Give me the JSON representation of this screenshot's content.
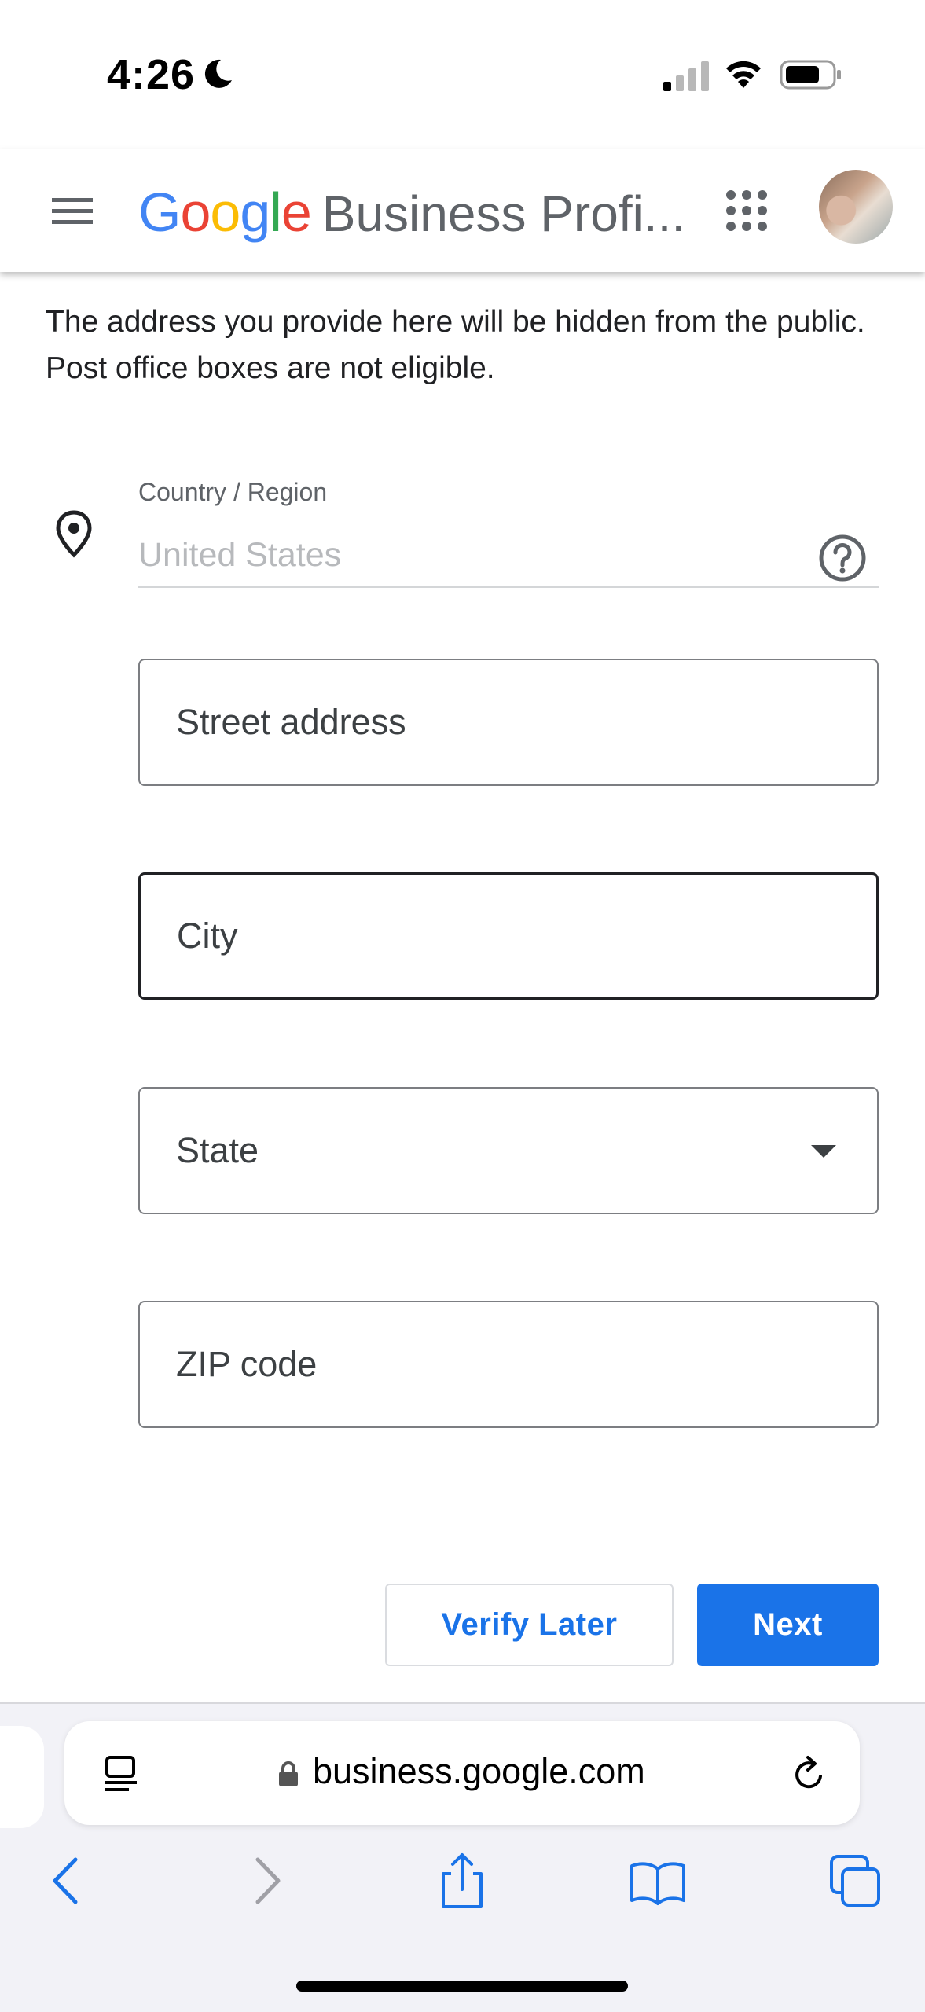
{
  "status_bar": {
    "time": "4:26"
  },
  "header": {
    "logo_text": "Google",
    "product_name": "Business Profi...",
    "logo_colors": [
      "#4285F4",
      "#EA4335",
      "#FBBC05",
      "#4285F4",
      "#34A853",
      "#EA4335"
    ]
  },
  "content": {
    "intro_text": "The address you provide here will be hidden from the public. Post office boxes are not eligible.",
    "country": {
      "label": "Country / Region",
      "value": "United States"
    },
    "fields": {
      "street": {
        "placeholder": "Street address"
      },
      "city": {
        "placeholder": "City"
      },
      "state": {
        "placeholder": "State"
      },
      "zip": {
        "placeholder": "ZIP code"
      }
    },
    "buttons": {
      "verify_later": "Verify Later",
      "next": "Next"
    }
  },
  "browser": {
    "url": "business.google.com"
  },
  "colors": {
    "accent": "#1a73e8",
    "text": "#202124",
    "secondary_text": "#5f6368"
  }
}
